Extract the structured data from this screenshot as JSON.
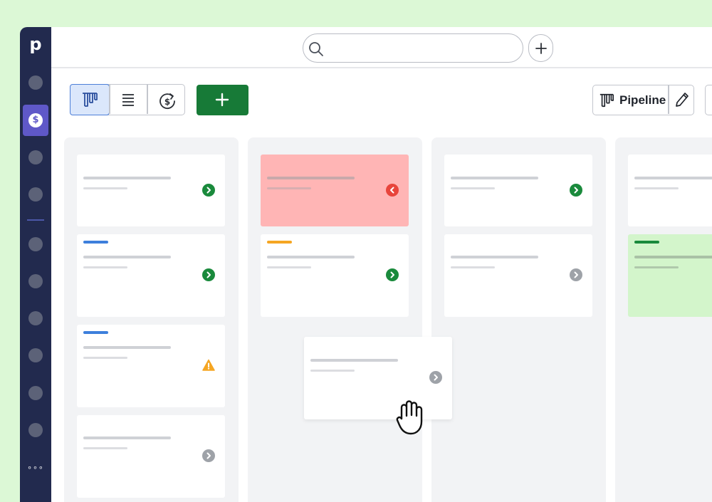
{
  "brand": {
    "logo_letter": "p"
  },
  "sidebar": {
    "active_item_icon": "dollar-coin-icon",
    "active_item_symbol": "$",
    "more_label": "∘∘∘"
  },
  "topbar": {
    "search": {
      "value": "",
      "placeholder": ""
    },
    "quick_add_icon": "plus-icon"
  },
  "toolbar": {
    "views": [
      {
        "name": "pipeline-view",
        "icon": "kanban-icon",
        "active": true
      },
      {
        "name": "list-view",
        "icon": "list-icon",
        "active": false
      },
      {
        "name": "forecast-view",
        "icon": "forecast-coin-icon",
        "active": false
      }
    ],
    "add_deal_icon": "plus-icon",
    "pipeline_label": "Pipeline",
    "edit_icon": "pencil-icon"
  },
  "colors": {
    "accent_green": "#177a37",
    "sidebar_bg": "#222a4e",
    "active_nav": "#5f58c8",
    "danger": "#e8453c",
    "warning": "#f5a623",
    "stripe_blue": "#3d7fdc",
    "stripe_orange": "#f5a623",
    "stripe_green": "#1a8a3c",
    "card_red_bg": "#ffb5b5",
    "card_green_bg": "#d3f5cb"
  },
  "board": {
    "columns": [
      {
        "cards": [
          {
            "stripe": null,
            "status": "on-track"
          },
          {
            "stripe": "blue",
            "status": "on-track"
          },
          {
            "stripe": "blue",
            "status": "warning"
          },
          {
            "stripe": null,
            "status": "idle"
          }
        ]
      },
      {
        "cards": [
          {
            "stripe": null,
            "status": "overdue",
            "highlight": "red"
          },
          {
            "stripe": "orange",
            "status": "on-track"
          }
        ]
      },
      {
        "cards": [
          {
            "stripe": null,
            "status": "on-track"
          },
          {
            "stripe": null,
            "status": "idle"
          }
        ]
      },
      {
        "cards": [
          {
            "stripe": null,
            "status": null
          },
          {
            "stripe": "green",
            "status": null,
            "highlight": "green"
          }
        ]
      }
    ],
    "dragged_card": {
      "status": "idle",
      "cursor": "grab-hand-icon"
    }
  }
}
